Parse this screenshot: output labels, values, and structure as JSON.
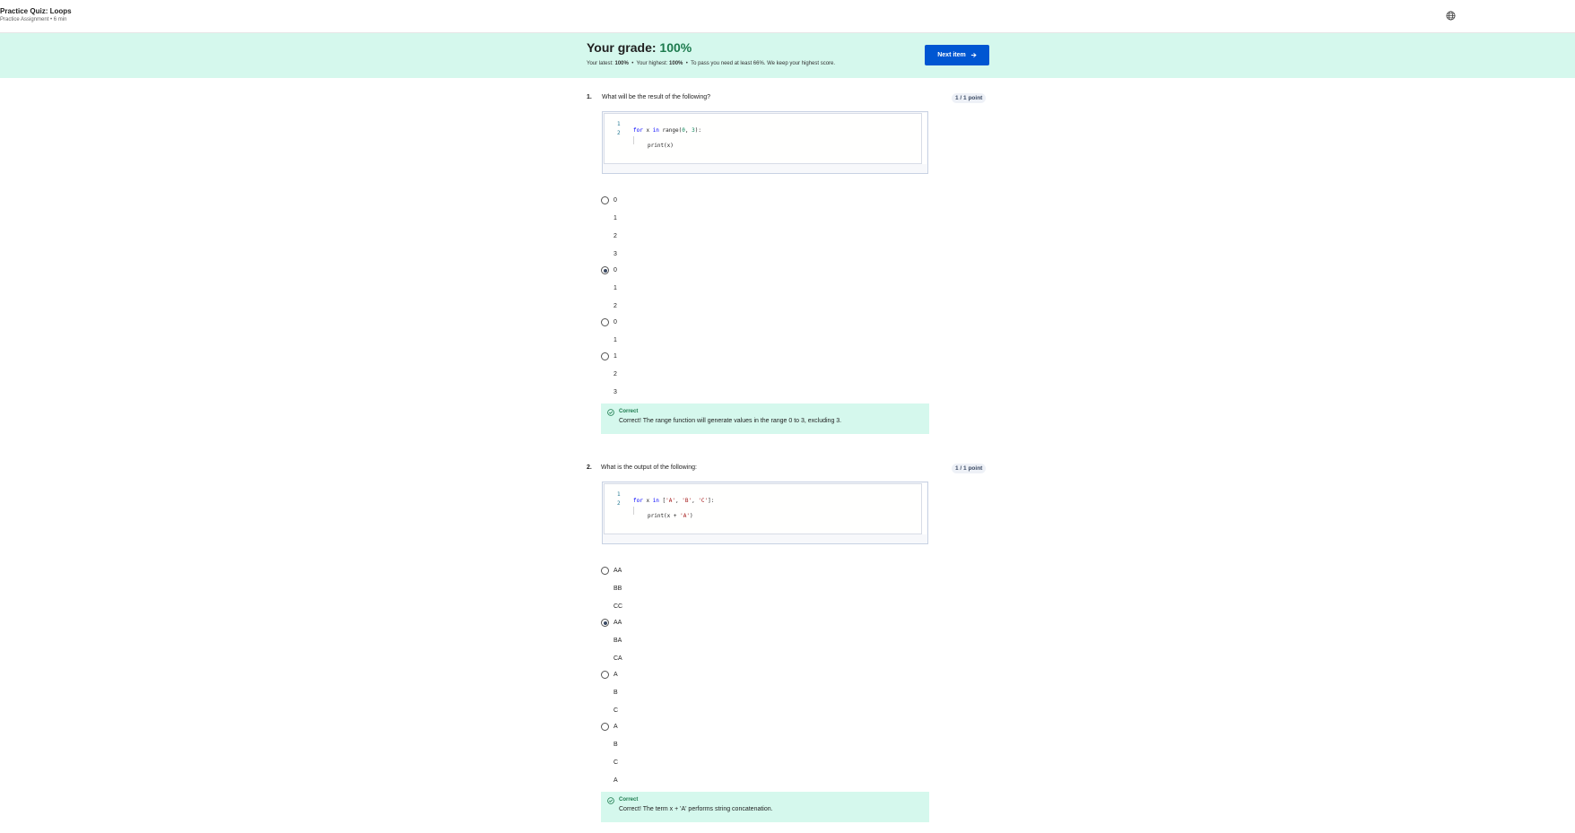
{
  "header": {
    "title": "Practice Quiz: Loops",
    "subtitle": "Practice Assignment • 6 min",
    "language_icon": "globe-icon"
  },
  "grade": {
    "label": "Your grade:",
    "value": "100%",
    "latest_label": "Your latest:",
    "latest_value": "100%",
    "highest_label": "Your highest:",
    "highest_value": "100%",
    "pass_text": "To pass you need at least 66%. We keep your highest score.",
    "separator": "•",
    "next_button": "Next item"
  },
  "questions": [
    {
      "number": "1.",
      "text": "What will be the result of the following?",
      "points": "1 / 1 point",
      "code_lines": [
        "1",
        "2"
      ],
      "options": [
        [
          "0",
          "1",
          "2",
          "3"
        ],
        [
          "0",
          "1",
          "2"
        ],
        [
          "0",
          "1"
        ],
        [
          "1",
          "2",
          "3"
        ]
      ],
      "selected_option": 2,
      "feedback_title": "Correct",
      "feedback_text": "Correct! The range function will generate values in the range 0 to 3, excluding 3."
    },
    {
      "number": "2.",
      "text": "What is the output of the following:",
      "points": "1 / 1 point",
      "code_lines": [
        "1",
        "2"
      ],
      "options": [
        [
          "AA",
          "BB",
          "CC"
        ],
        [
          "AA",
          "BA",
          "CA"
        ],
        [
          "A",
          "B",
          "C"
        ],
        [
          "A",
          "B",
          "C",
          "A"
        ]
      ],
      "selected_option": 2,
      "feedback_title": "Correct",
      "feedback_text": "Correct! The term x + 'A' performs string concatenation."
    }
  ],
  "code": {
    "q1": {
      "l1_kw1": "for",
      "l1_var": " x ",
      "l1_kw2": "in",
      "l1_fn": " range(",
      "l1_n1": "0",
      "l1_comma": ", ",
      "l1_n2": "3",
      "l1_end": "):",
      "l2": "print(x)"
    },
    "q2": {
      "l1_kw1": "for",
      "l1_var": " x ",
      "l1_kw2": "in",
      "l1_open": " [",
      "l1_s1": "'A'",
      "l1_c1": ", ",
      "l1_s2": "'B'",
      "l1_c2": ", ",
      "l1_s3": "'C'",
      "l1_end": "]:",
      "l2_a": "print(x + ",
      "l2_s": "'A'",
      "l2_b": ")"
    }
  },
  "colors": {
    "banner": "#d5f8ed",
    "primary": "#0056d2",
    "success": "#1c7a4d"
  }
}
